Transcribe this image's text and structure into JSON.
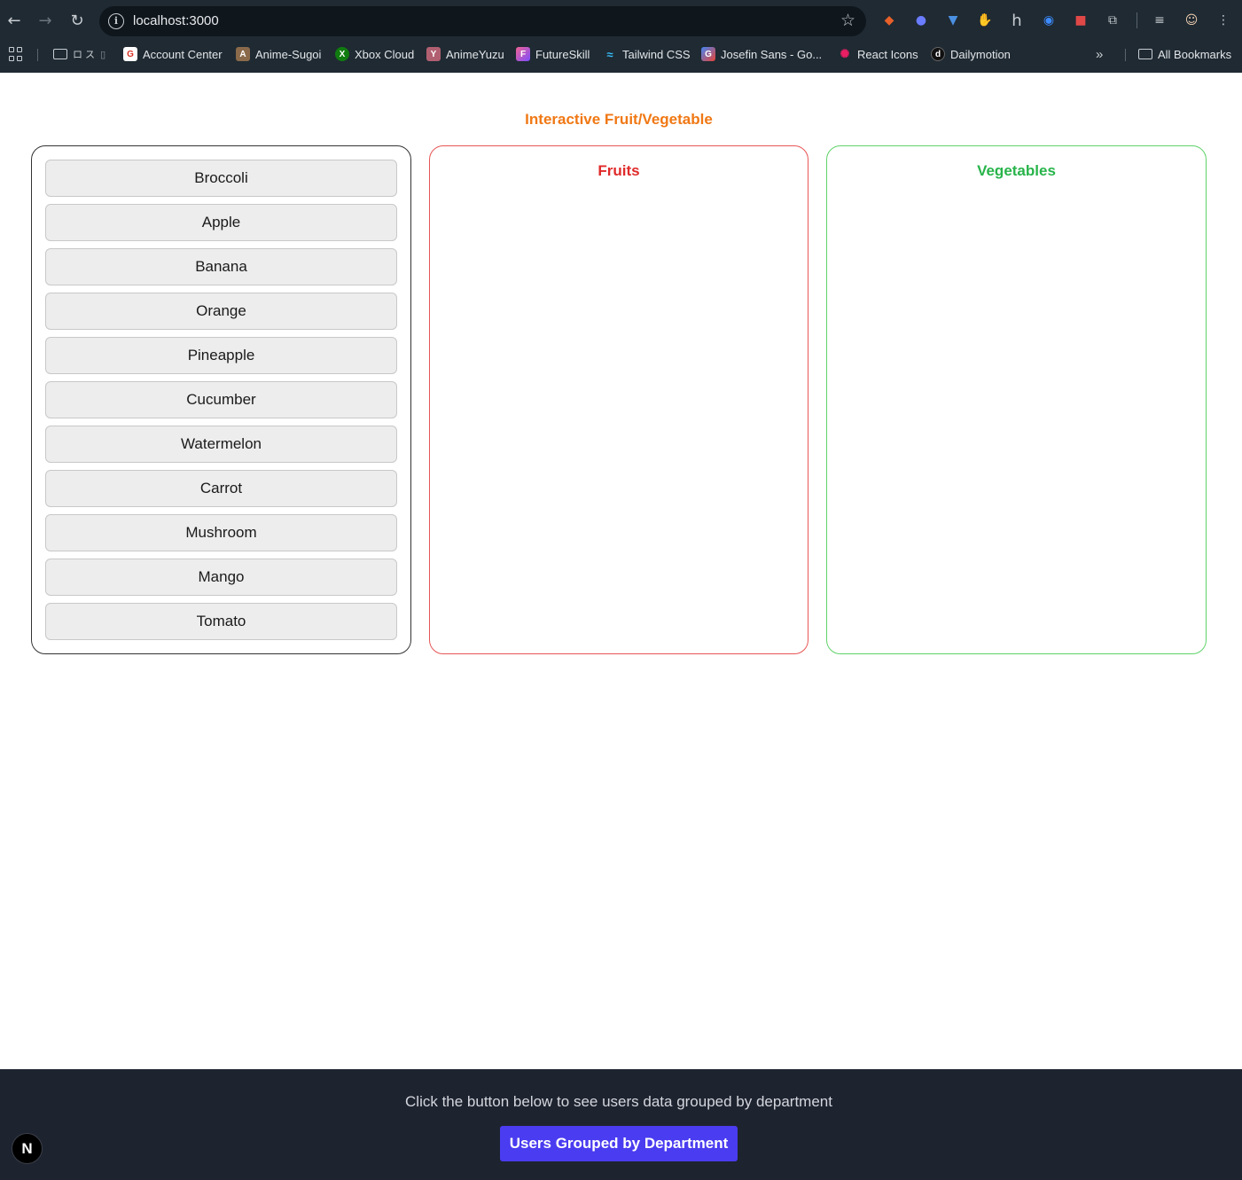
{
  "browser": {
    "url": "localhost:3000",
    "bookmarks": [
      {
        "label": "Account Center",
        "icon": "account-center-icon",
        "color": "#d93025"
      },
      {
        "label": "Anime-Sugoi",
        "icon": "anime-sugoi-icon",
        "color": "#8a6a4a"
      },
      {
        "label": "Xbox Cloud",
        "icon": "xbox-icon",
        "color": "#107c10"
      },
      {
        "label": "AnimeYuzu",
        "icon": "animeyuzu-icon",
        "color": "#b06070"
      },
      {
        "label": "FutureSkill",
        "icon": "futureskill-icon",
        "color": "#a64ef0"
      },
      {
        "label": "Tailwind CSS",
        "icon": "tailwind-icon",
        "color": "#38bdf8"
      },
      {
        "label": "Josefin Sans - Go...",
        "icon": "google-fonts-icon",
        "color": "#4285f4"
      },
      {
        "label": "React Icons",
        "icon": "react-icons-icon",
        "color": "#e91e63"
      },
      {
        "label": "Dailymotion",
        "icon": "dailymotion-icon",
        "color": "#111111"
      }
    ],
    "folder_label": "ロ ス",
    "all_bookmarks": "All Bookmarks"
  },
  "page": {
    "title": "Interactive Fruit/Vegetable",
    "items": [
      "Broccoli",
      "Apple",
      "Banana",
      "Orange",
      "Pineapple",
      "Cucumber",
      "Watermelon",
      "Carrot",
      "Mushroom",
      "Mango",
      "Tomato"
    ],
    "fruits_heading": "Fruits",
    "vegetables_heading": "Vegetables"
  },
  "footer": {
    "text": "Click the button below to see users data grouped by department",
    "button": "Users Grouped by Department",
    "badge": "N"
  },
  "colors": {
    "title": "#f07814",
    "fruits": "#e02a2a",
    "vegetables": "#28b44a",
    "footer_bg": "#1e2330",
    "button_bg": "#4a3cf0"
  }
}
